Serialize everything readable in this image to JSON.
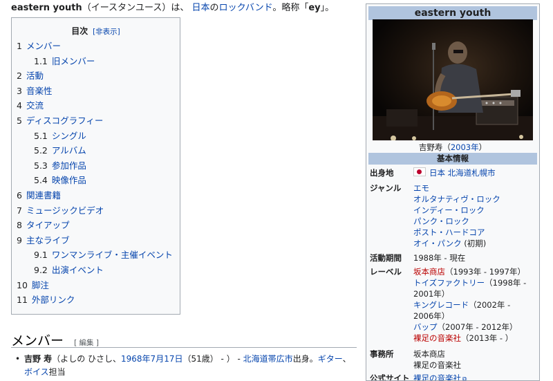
{
  "lead": {
    "name": "eastern youth",
    "reading": "（イースタンユース）は、",
    "country": "日本",
    "no": "の",
    "genre": "ロックバンド",
    "abbr_pre": "。略称「",
    "abbr": "ey",
    "abbr_post": "」。"
  },
  "toc": {
    "title": "目次",
    "hide": "[非表示]",
    "items": [
      {
        "num": "1",
        "label": "メンバー"
      },
      {
        "num": "1.1",
        "label": "旧メンバー"
      },
      {
        "num": "2",
        "label": "活動"
      },
      {
        "num": "3",
        "label": "音楽性"
      },
      {
        "num": "4",
        "label": "交流"
      },
      {
        "num": "5",
        "label": "ディスコグラフィー"
      },
      {
        "num": "5.1",
        "label": "シングル"
      },
      {
        "num": "5.2",
        "label": "アルバム"
      },
      {
        "num": "5.3",
        "label": "参加作品"
      },
      {
        "num": "5.4",
        "label": "映像作品"
      },
      {
        "num": "6",
        "label": "関連書籍"
      },
      {
        "num": "7",
        "label": "ミュージックビデオ"
      },
      {
        "num": "8",
        "label": "タイアップ"
      },
      {
        "num": "9",
        "label": "主なライブ"
      },
      {
        "num": "9.1",
        "label": "ワンマンライブ・主催イベント"
      },
      {
        "num": "9.2",
        "label": "出演イベント"
      },
      {
        "num": "10",
        "label": "脚注"
      },
      {
        "num": "11",
        "label": "外部リンク"
      }
    ]
  },
  "section": {
    "heading": "メンバー",
    "edit": "[ 編集 ]"
  },
  "member": {
    "name": "吉野 寿",
    "paren_open": "（よしの ひさし、",
    "birth": "1968年7月17日",
    "age": "（51歳） - ） - ",
    "birthplace": "北海道帯広市",
    "born": "出身。",
    "role1": "ギター",
    "sep": "、",
    "role2": "ボイス",
    "tail": "担当"
  },
  "infobox": {
    "title": "eastern youth",
    "caption_name": "吉野寿（",
    "caption_year": "2003年",
    "caption_close": "）",
    "section": "基本情報",
    "origin_label": "出身地",
    "origin_country": "日本",
    "origin_city": "北海道札幌市",
    "genre_label": "ジャンル",
    "genres": [
      "エモ",
      "オルタナティヴ・ロック",
      "インディー・ロック",
      "パンク・ロック",
      "ポスト・ハードコア",
      "オイ・パンク"
    ],
    "genre_note": "(初期)",
    "years_label": "活動期間",
    "years": "1988年 - 現在",
    "label_label": "レーベル",
    "labels": [
      {
        "name": "坂本商店",
        "period": "（1993年 - 1997年）",
        "red": true
      },
      {
        "name": "トイズファクトリー",
        "period": "（1998年 -",
        "red": false
      },
      {
        "name": "",
        "period": "2001年）",
        "red": false
      },
      {
        "name": "キングレコード",
        "period": "（2002年 -",
        "red": false
      },
      {
        "name": "",
        "period": "2006年）",
        "red": false
      },
      {
        "name": "バップ",
        "period": "（2007年 - 2012年）",
        "red": false
      },
      {
        "name": "裸足の音楽社",
        "period": "（2013年 - ）",
        "red": true
      }
    ],
    "office_label": "事務所",
    "offices": [
      "坂本商店",
      "裸足の音楽社"
    ],
    "site_label": "公式サイト",
    "site": "裸足の音楽社"
  }
}
